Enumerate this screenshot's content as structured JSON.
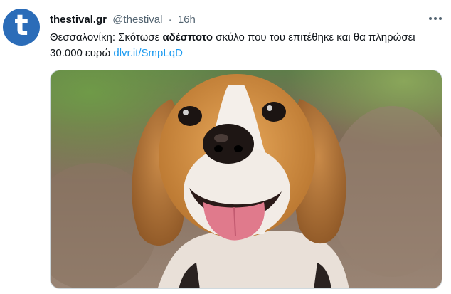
{
  "account": {
    "name": "thestival.gr",
    "handle": "@thestival",
    "separator": "·",
    "time": "16h",
    "avatar_letter": "t",
    "avatar_color": "#2b6cb8"
  },
  "tweet": {
    "text_before": "Θεσσαλονίκη: Σκότωσε ",
    "text_bold": "αδέσποτο",
    "text_after": " σκύλο που του επιτέθηκε και θα πληρώσει 30.000 ευρώ ",
    "link_text": "dlvr.it/SmpLqD"
  },
  "icons": {
    "more": "more-options-icon"
  },
  "media": {
    "subject": "beagle-photo"
  }
}
